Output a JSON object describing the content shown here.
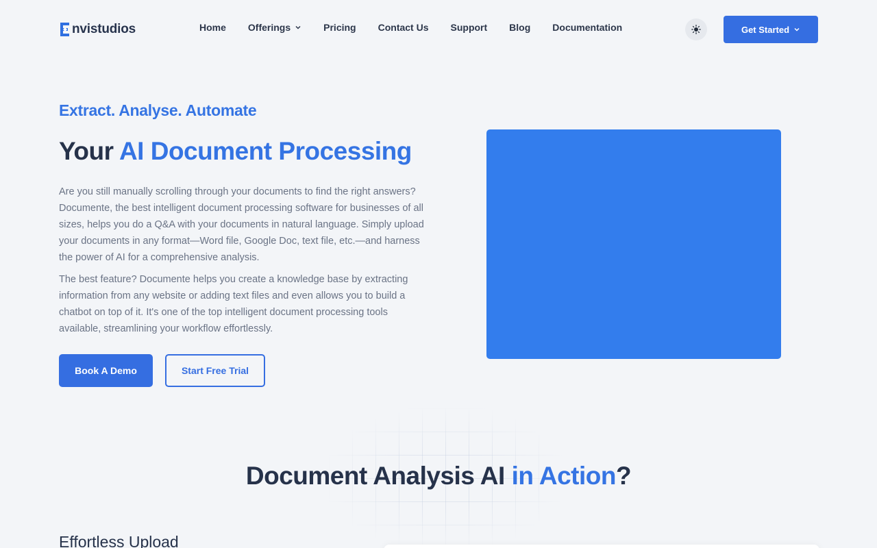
{
  "brand": {
    "name": "nvistudios",
    "accent_color": "#356ee1"
  },
  "nav": {
    "links": [
      {
        "label": "Home"
      },
      {
        "label": "Offerings",
        "has_dropdown": true
      },
      {
        "label": "Pricing"
      },
      {
        "label": "Contact Us"
      },
      {
        "label": "Support"
      },
      {
        "label": "Blog"
      },
      {
        "label": "Documentation"
      }
    ],
    "theme_icon": "sun-icon",
    "cta_label": "Get Started"
  },
  "hero": {
    "tagline": "Extract. Analyse. Automate",
    "title_plain": "Your ",
    "title_accent": "AI Document Processing",
    "paragraph_1": "Are you still manually scrolling through your documents to find the right answers? Documente, the best intelligent document processing software for businesses of all sizes, helps you do a Q&A with your documents in natural language. Simply upload your documents in any format—Word file, Google Doc, text file, etc.—and harness the power of AI for a comprehensive analysis.",
    "paragraph_2": "The best feature? Documente helps you create a knowledge base by extracting information from any website or adding text files and even allows you to build a chatbot on top of it. It's one of the top intelligent document processing tools available, streamlining your workflow effortlessly.",
    "primary_button": "Book A Demo",
    "secondary_button": "Start Free Trial",
    "visual_color": "#337ded"
  },
  "section": {
    "title_plain": "Document Analysis AI ",
    "title_accent": "in Action",
    "title_suffix": "?",
    "sub_heading": "Effortless Upload"
  }
}
